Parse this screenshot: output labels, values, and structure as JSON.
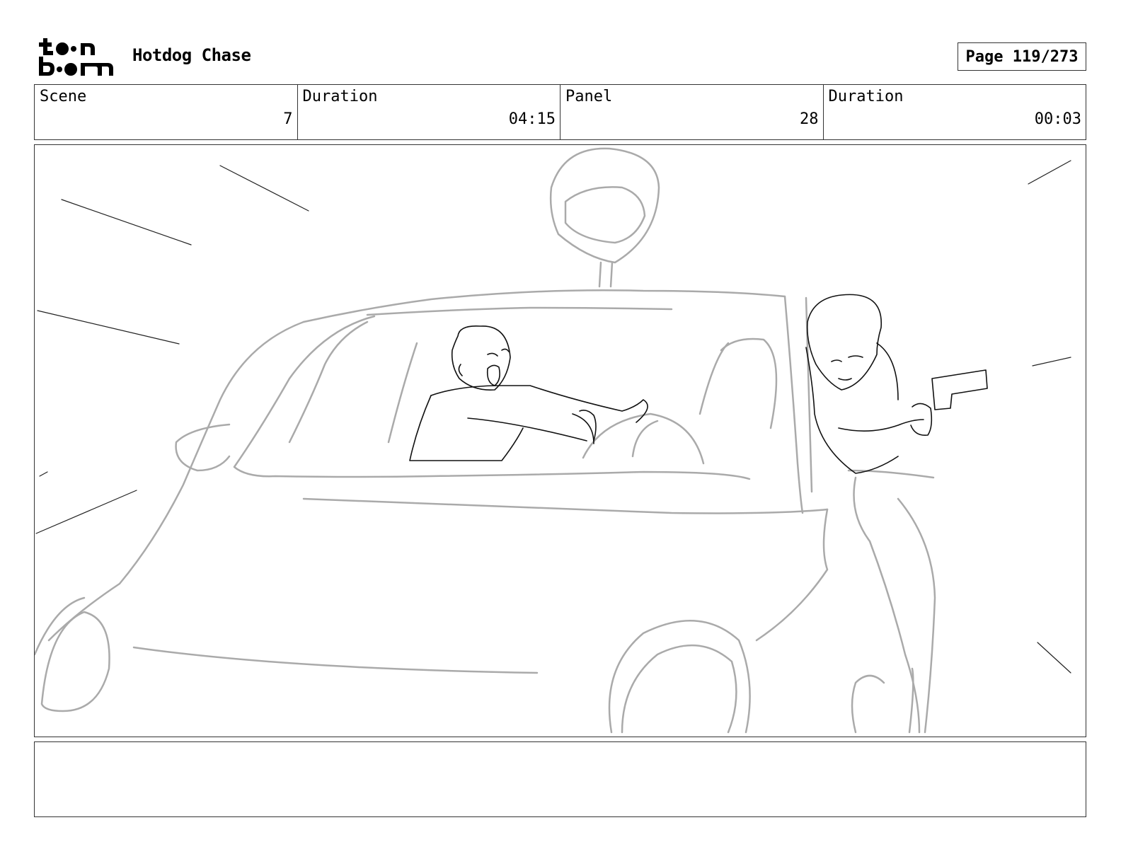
{
  "header": {
    "logo_text": "toon boom",
    "project_title": "Hotdog Chase",
    "page_label": "Page 119/273"
  },
  "info": {
    "scene_label": "Scene",
    "scene_value": "7",
    "scene_duration_label": "Duration",
    "scene_duration_value": "04:15",
    "panel_label": "Panel",
    "panel_value": "28",
    "panel_duration_label": "Duration",
    "panel_duration_value": "00:03"
  },
  "notes": {
    "text": ""
  }
}
